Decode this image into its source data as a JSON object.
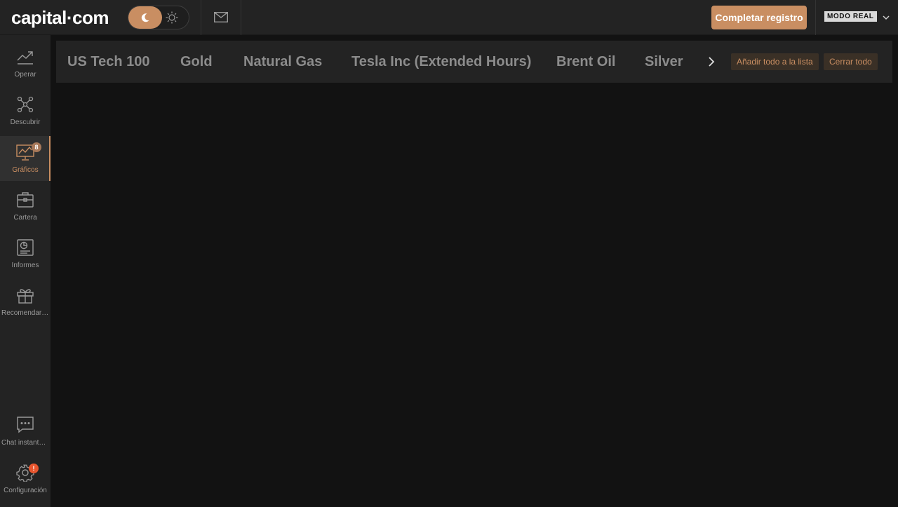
{
  "header": {
    "logo": "capital·com",
    "complete_label": "Completar registro",
    "mode_label": "MODO REAL"
  },
  "sidebar": {
    "items": [
      {
        "label": "Operar",
        "icon": "trending-up-icon"
      },
      {
        "label": "Descubrir",
        "icon": "network-icon"
      },
      {
        "label": "Gráficos",
        "icon": "chart-monitor-icon",
        "badge": "8"
      },
      {
        "label": "Cartera",
        "icon": "briefcase-icon"
      },
      {
        "label": "Informes",
        "icon": "report-icon"
      },
      {
        "label": "Recomendar amigos",
        "icon": "gift-icon"
      }
    ],
    "bottom": [
      {
        "label": "Chat instantáneo",
        "icon": "chat-icon"
      },
      {
        "label": "Configuración",
        "icon": "gear-icon",
        "badge": "!"
      }
    ]
  },
  "tabs": {
    "items": [
      "US Tech 100",
      "Gold",
      "Natural Gas",
      "Tesla Inc (Extended Hours)",
      "Brent Oil",
      "Silver"
    ],
    "add_all_label": "Añadir todo a la lista",
    "close_all_label": "Cerrar todo"
  },
  "colors": {
    "accent": "#c98e62",
    "background": "#121212",
    "panel": "#232323",
    "alert": "#e8552e"
  }
}
